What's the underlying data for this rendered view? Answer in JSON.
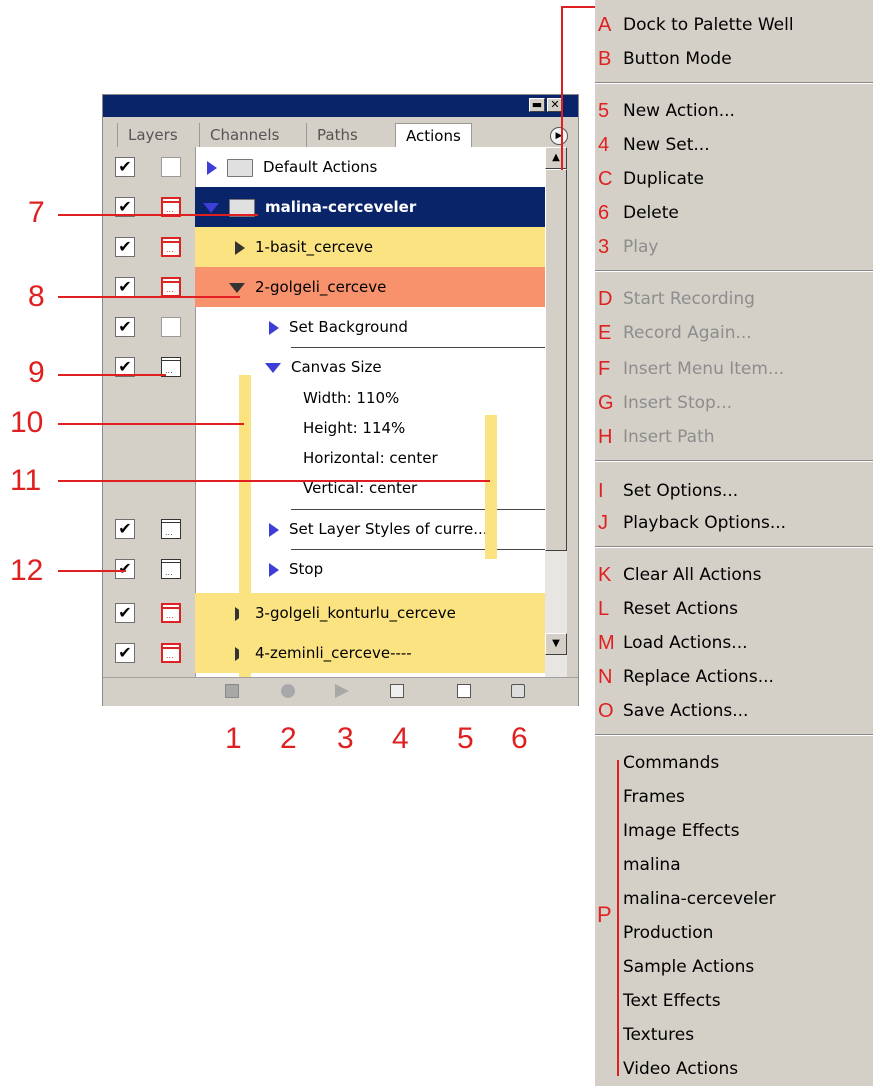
{
  "palette": {
    "tabs": [
      "Layers",
      "Channels",
      "Paths",
      "Actions"
    ],
    "active_tab": "Actions",
    "title_buttons": {
      "minimize": "▬",
      "close": "✕"
    },
    "rows": [
      {
        "label": "Default Actions",
        "checked": "✔"
      },
      {
        "label": "malina-cerceveler",
        "checked": "✔"
      },
      {
        "label": "1-basit_cerceve",
        "checked": "✔"
      },
      {
        "label": "2-golgeli_cerceve",
        "checked": "✔"
      },
      {
        "label": "Set Background",
        "checked": "✔"
      },
      {
        "label": "Canvas Size",
        "checked": "✔"
      },
      {
        "label": "Width: 110%"
      },
      {
        "label": "Height: 114%"
      },
      {
        "label": "Horizontal: center"
      },
      {
        "label": "Vertical: center"
      },
      {
        "label": "Set Layer Styles of curre...",
        "checked": "✔"
      },
      {
        "label": "Stop",
        "checked": "✔"
      },
      {
        "label": "3-golgeli_konturlu_cerceve",
        "checked": "✔"
      },
      {
        "label": "4-zeminli_cerceve----",
        "checked": "✔"
      }
    ],
    "colors": {
      "selected": "#0a246a",
      "highlight_yellow": "#fbe382",
      "highlight_salmon": "#f7926d",
      "annotation_red": "#e02020"
    }
  },
  "annotations": {
    "left": [
      "7",
      "8",
      "9",
      "10",
      "11",
      "12"
    ],
    "bottom": [
      "1",
      "2",
      "3",
      "4",
      "5",
      "6"
    ]
  },
  "menu": {
    "items": [
      {
        "letter": "A",
        "label": "Dock to Palette Well"
      },
      {
        "letter": "B",
        "label": "Button Mode"
      },
      {
        "letter": "5",
        "label": "New Action..."
      },
      {
        "letter": "4",
        "label": "New Set..."
      },
      {
        "letter": "C",
        "label": "Duplicate"
      },
      {
        "letter": "6",
        "label": "Delete"
      },
      {
        "letter": "3",
        "label": "Play",
        "disabled": true
      },
      {
        "letter": "D",
        "label": "Start Recording",
        "disabled": true
      },
      {
        "letter": "E",
        "label": "Record Again...",
        "disabled": true
      },
      {
        "letter": "F",
        "label": "Insert Menu Item...",
        "disabled": true
      },
      {
        "letter": "G",
        "label": "Insert Stop...",
        "disabled": true
      },
      {
        "letter": "H",
        "label": "Insert Path",
        "disabled": true
      },
      {
        "letter": "I",
        "label": "Set Options..."
      },
      {
        "letter": "J",
        "label": "Playback Options..."
      },
      {
        "letter": "K",
        "label": "Clear All Actions"
      },
      {
        "letter": "L",
        "label": "Reset Actions"
      },
      {
        "letter": "M",
        "label": "Load Actions..."
      },
      {
        "letter": "N",
        "label": "Replace Actions..."
      },
      {
        "letter": "O",
        "label": "Save Actions..."
      }
    ],
    "sets_letter": "P",
    "sets": [
      "Commands",
      "Frames",
      "Image Effects",
      "malina",
      "malina-cerceveler",
      "Production",
      "Sample Actions",
      "Text Effects",
      "Textures",
      "Video Actions"
    ]
  }
}
